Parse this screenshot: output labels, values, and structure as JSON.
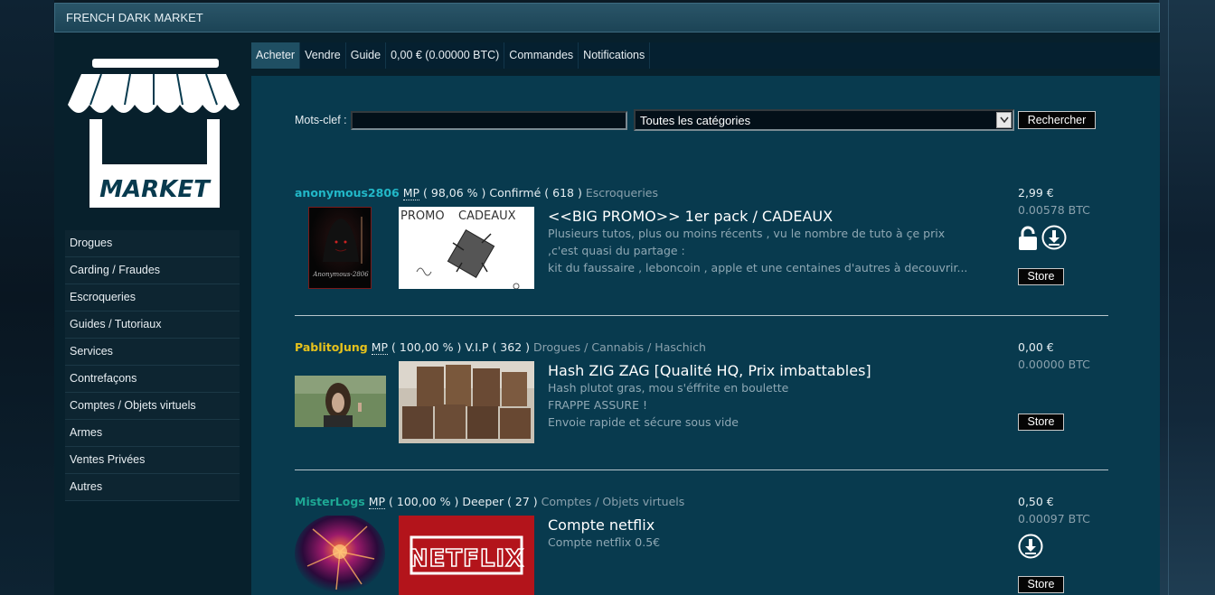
{
  "app": {
    "title": "FRENCH DARK MARKET"
  },
  "logo": {
    "text": "MARKET"
  },
  "nav": {
    "items": [
      "Acheter",
      "Vendre",
      "Guide",
      "0,00 € (0.00000 BTC)",
      "Commandes",
      "Notifications"
    ],
    "active": "Acheter"
  },
  "categories": [
    "Drogues",
    "Carding / Fraudes",
    "Escroqueries",
    "Guides / Tutoriaux",
    "Services",
    "Contrefaçons",
    "Comptes / Objets virtuels",
    "Armes",
    "Ventes Privées",
    "Autres"
  ],
  "search": {
    "label": "Mots-clef :",
    "value": "",
    "category_selected": "Toutes les catégories",
    "button": "Rechercher"
  },
  "listings": [
    {
      "seller": "anonymous2806",
      "seller_color": "#22b8c8",
      "mp": "MP",
      "rating": "( 98,06 % )",
      "level": "Confirmé",
      "count": "( 618 )",
      "category": "Escroqueries",
      "avatar_caption": "Anonymous-2806",
      "product_image_text": [
        "PROMO",
        "CADEAUX"
      ],
      "title": "<<BIG PROMO>> 1er pack / CADEAUX",
      "desc": [
        "Plusieurs tutos, plus ou moins récents , vu le nombre de tuto à çe prix",
        ",c'est quasi du partage :",
        "kit du faussaire , leboncoin , apple et une centaines d'autres à decouvrir..."
      ],
      "price_eur": "2,99 €",
      "price_btc": "0.00578 BTC",
      "icons": [
        "unlock-icon",
        "download-icon"
      ],
      "store": "Store"
    },
    {
      "seller": "PablitoJung",
      "seller_color": "#e6c21c",
      "mp": "MP",
      "rating": "( 100,00 % )",
      "level": "V.I.P",
      "count": "( 362 )",
      "category": "Drogues / Cannabis / Haschich",
      "title": "Hash ZIG ZAG [Qualité HQ, Prix imbattables]",
      "desc": [
        "Hash plutot gras, mou s'éffrite en boulette",
        "FRAPPE ASSURE !",
        "Envoie rapide et sécure sous vide"
      ],
      "price_eur": "0,00 €",
      "price_btc": "0.00000 BTC",
      "icons": [],
      "store": "Store"
    },
    {
      "seller": "MisterLogs",
      "seller_color": "#1ea894",
      "mp": "MP",
      "rating": "( 100,00 % )",
      "level": "Deeper",
      "count": "( 27 )",
      "category": "Comptes / Objets virtuels",
      "product_image_text": [
        "NETFLIX"
      ],
      "title": "Compte netflix",
      "desc": [
        "Compte netflix 0.5€"
      ],
      "price_eur": "0,50 €",
      "price_btc": "0.00097 BTC",
      "icons": [
        "download-icon"
      ],
      "store": "Store"
    }
  ]
}
